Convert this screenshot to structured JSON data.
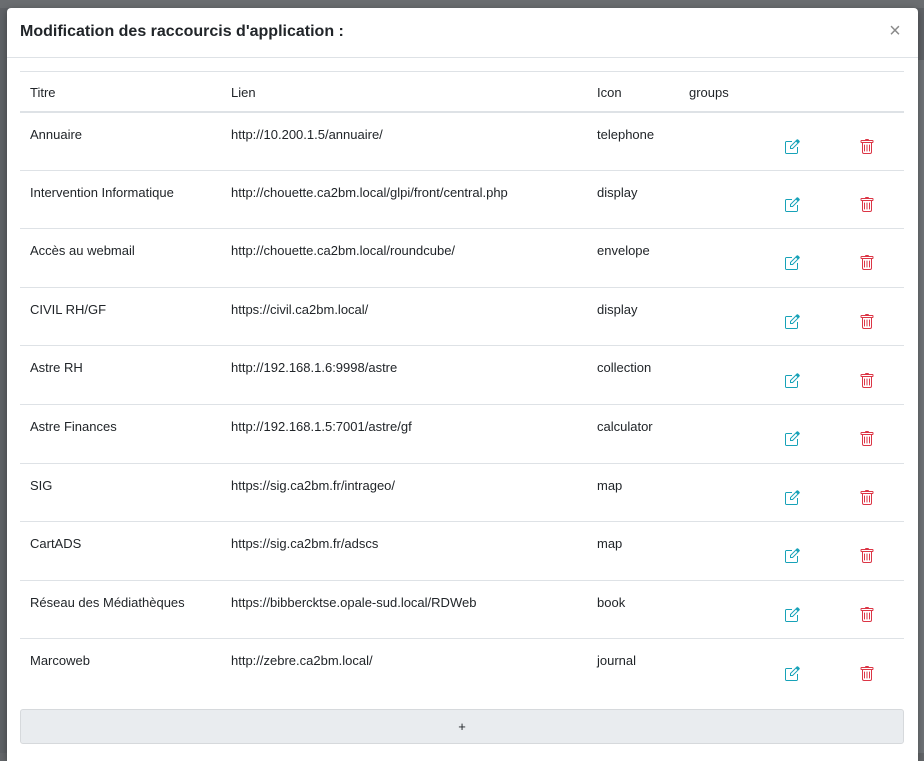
{
  "modal": {
    "title": "Modification des raccourcis d'application :",
    "close_glyph": "×",
    "add_label": "+"
  },
  "table": {
    "headers": {
      "title": "Titre",
      "link": "Lien",
      "icon": "Icon",
      "groups": "groups"
    },
    "rows": [
      {
        "title": "Annuaire",
        "link": "http://10.200.1.5/annuaire/",
        "icon": "telephone"
      },
      {
        "title": "Intervention Informatique",
        "link": "http://chouette.ca2bm.local/glpi/front/central.php",
        "icon": "display"
      },
      {
        "title": "Accès au webmail",
        "link": "http://chouette.ca2bm.local/roundcube/",
        "icon": "envelope"
      },
      {
        "title": "CIVIL RH/GF",
        "link": "https://civil.ca2bm.local/",
        "icon": "display"
      },
      {
        "title": "Astre RH",
        "link": "http://192.168.1.6:9998/astre",
        "icon": "collection"
      },
      {
        "title": "Astre Finances",
        "link": "http://192.168.1.5:7001/astre/gf",
        "icon": "calculator"
      },
      {
        "title": "SIG",
        "link": "https://sig.ca2bm.fr/intrageo/",
        "icon": "map"
      },
      {
        "title": "CartADS",
        "link": "https://sig.ca2bm.fr/adscs",
        "icon": "map"
      },
      {
        "title": "Réseau des Médiathèques",
        "link": "https://bibbercktse.opale-sud.local/RDWeb",
        "icon": "book"
      },
      {
        "title": "Marcoweb",
        "link": "http://zebre.ca2bm.local/",
        "icon": "journal"
      }
    ]
  },
  "icons": {
    "edit": "pencil-square-icon",
    "delete": "trash-icon"
  },
  "colors": {
    "edit": "#17a2b8",
    "delete": "#dc3545",
    "overlay": "#5f6266"
  }
}
